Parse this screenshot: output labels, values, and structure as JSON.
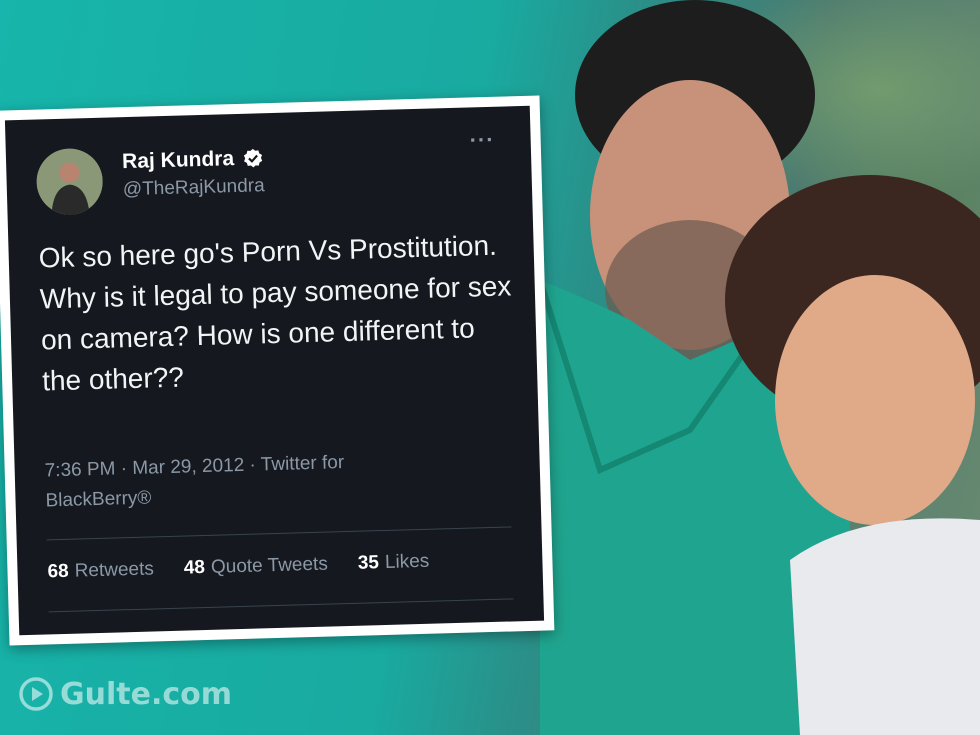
{
  "tweet": {
    "display_name": "Raj Kundra",
    "handle": "@TheRajKundra",
    "text": "Ok so here go's Porn Vs Prostitution. Why is it legal to pay someone for sex on camera? How is one different to the other??",
    "meta": "7:36 PM · Mar 29, 2012 · Twitter for BlackBerry®",
    "more_label": "···",
    "stats": {
      "retweets_count": "68",
      "retweets_label": "Retweets",
      "quotes_count": "48",
      "quotes_label": "Quote Tweets",
      "likes_count": "35",
      "likes_label": "Likes"
    }
  },
  "watermark": {
    "text": "Gulte.com"
  },
  "colors": {
    "background_teal": "#1bb3a8",
    "tweet_bg": "#15181f",
    "verified": "#ffffff"
  }
}
